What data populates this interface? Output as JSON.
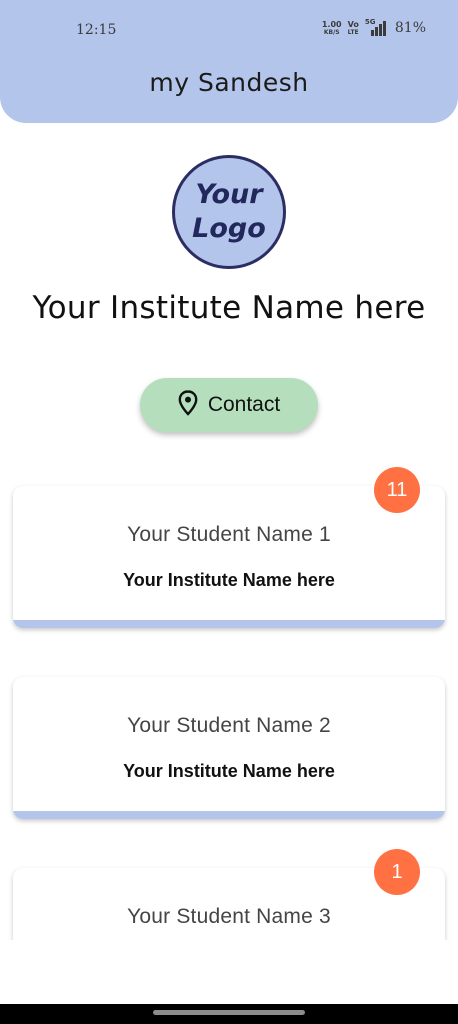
{
  "status_bar": {
    "time": "12:15",
    "net_speed_value": "1.00",
    "net_speed_unit": "KB/S",
    "volte_top": "Vo",
    "volte_bottom": "LTE",
    "network": "5G",
    "battery": "81%"
  },
  "header": {
    "title": "my Sandesh"
  },
  "logo": {
    "line1": "Your",
    "line2": "Logo"
  },
  "institute_name": "Your Institute Name here",
  "contact_button": {
    "label": "Contact",
    "icon": "location-pin-icon"
  },
  "cards": [
    {
      "student_name": "Your Student Name 1",
      "institute": "Your Institute Name here",
      "badge": "11"
    },
    {
      "student_name": "Your Student Name 2",
      "institute": "Your Institute Name here",
      "badge": ""
    },
    {
      "student_name": "Your Student Name 3",
      "institute": "",
      "badge": "1"
    }
  ],
  "colors": {
    "header_bg": "#b4c5ec",
    "contact_bg": "#b5dfbc",
    "badge": "#ff7043",
    "card_bar": "#b4c5ec"
  }
}
